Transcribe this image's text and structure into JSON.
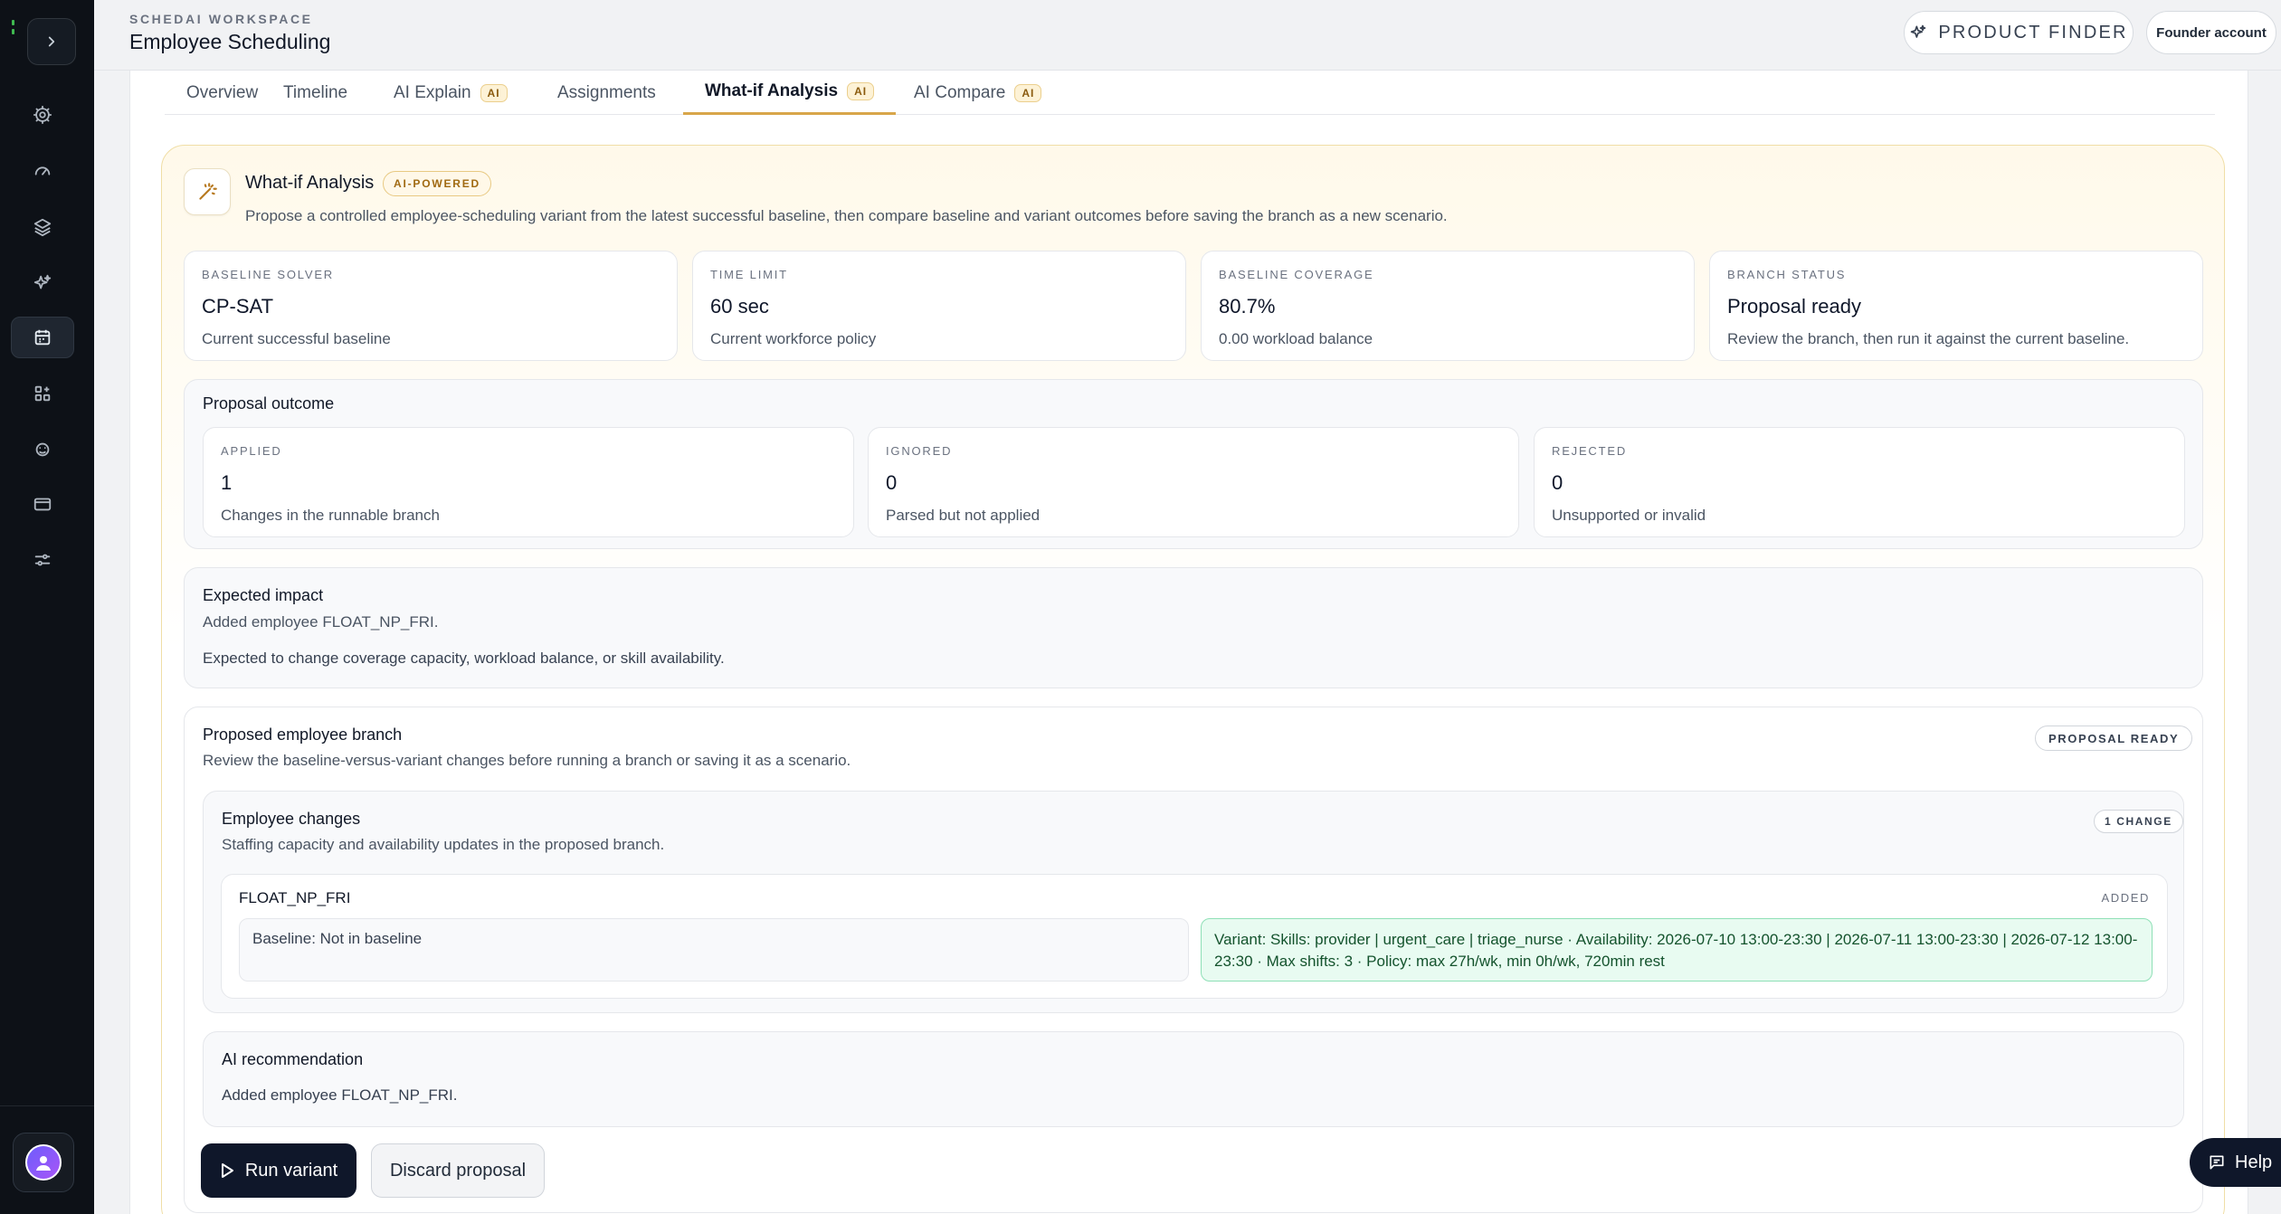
{
  "header": {
    "workspace_label": "SCHEDAI WORKSPACE",
    "title": "Employee Scheduling",
    "product_finder": "PRODUCT FINDER",
    "account": "Founder account"
  },
  "tabs": [
    {
      "label": "Overview"
    },
    {
      "label": "Timeline"
    },
    {
      "label": "AI Explain",
      "badge": "AI"
    },
    {
      "label": "Assignments"
    },
    {
      "label": "What-if Analysis",
      "badge": "AI",
      "active": true
    },
    {
      "label": "AI Compare",
      "badge": "AI"
    }
  ],
  "analysis": {
    "title": "What-if Analysis",
    "badge": "AI-POWERED",
    "description": "Propose a controlled employee-scheduling variant from the latest successful baseline, then compare baseline and variant outcomes before saving the branch as a new scenario."
  },
  "stats": [
    {
      "label": "BASELINE SOLVER",
      "value": "CP-SAT",
      "sub": "Current successful baseline"
    },
    {
      "label": "TIME LIMIT",
      "value": "60 sec",
      "sub": "Current workforce policy"
    },
    {
      "label": "BASELINE COVERAGE",
      "value": "80.7%",
      "sub": "0.00 workload balance"
    },
    {
      "label": "BRANCH STATUS",
      "value": "Proposal ready",
      "sub": "Review the branch, then run it against the current baseline."
    }
  ],
  "outcome": {
    "title": "Proposal outcome",
    "items": [
      {
        "label": "APPLIED",
        "value": "1",
        "sub": "Changes in the runnable branch"
      },
      {
        "label": "IGNORED",
        "value": "0",
        "sub": "Parsed but not applied"
      },
      {
        "label": "REJECTED",
        "value": "0",
        "sub": "Unsupported or invalid"
      }
    ]
  },
  "impact": {
    "title": "Expected impact",
    "line1": "Added employee FLOAT_NP_FRI.",
    "line2": "Expected to change coverage capacity, workload balance, or skill availability."
  },
  "branch": {
    "title": "Proposed employee branch",
    "description": "Review the baseline-versus-variant changes before running a branch or saving it as a scenario.",
    "status": "PROPOSAL READY",
    "changes": {
      "title": "Employee changes",
      "description": "Staffing capacity and availability updates in the proposed branch.",
      "count": "1 CHANGE",
      "employee": {
        "name": "FLOAT_NP_FRI",
        "tag": "ADDED",
        "baseline": "Baseline: Not in baseline",
        "variant": "Variant: Skills: provider | urgent_care | triage_nurse · Availability: 2026-07-10 13:00-23:30 | 2026-07-11 13:00-23:30 | 2026-07-12 13:00-23:30 · Max shifts: 3 · Policy: max 27h/wk, min 0h/wk, 720min rest"
      }
    },
    "recommendation": {
      "title": "AI recommendation",
      "text": "Added employee FLOAT_NP_FRI."
    }
  },
  "actions": {
    "run": "Run variant",
    "discard": "Discard proposal"
  },
  "help": "Help",
  "colors": {
    "accent": "#d8a64a",
    "sidebar": "#0d1117",
    "variant_bg": "#e8fbf1",
    "primary_button": "#0f172a"
  },
  "icons": {
    "sidebar": [
      "settings-icon",
      "gauge-icon",
      "layers-icon",
      "sparkles-icon",
      "calendar-icon",
      "grid-plus-icon",
      "face-scan-icon",
      "credit-card-icon",
      "sliders-icon"
    ]
  }
}
